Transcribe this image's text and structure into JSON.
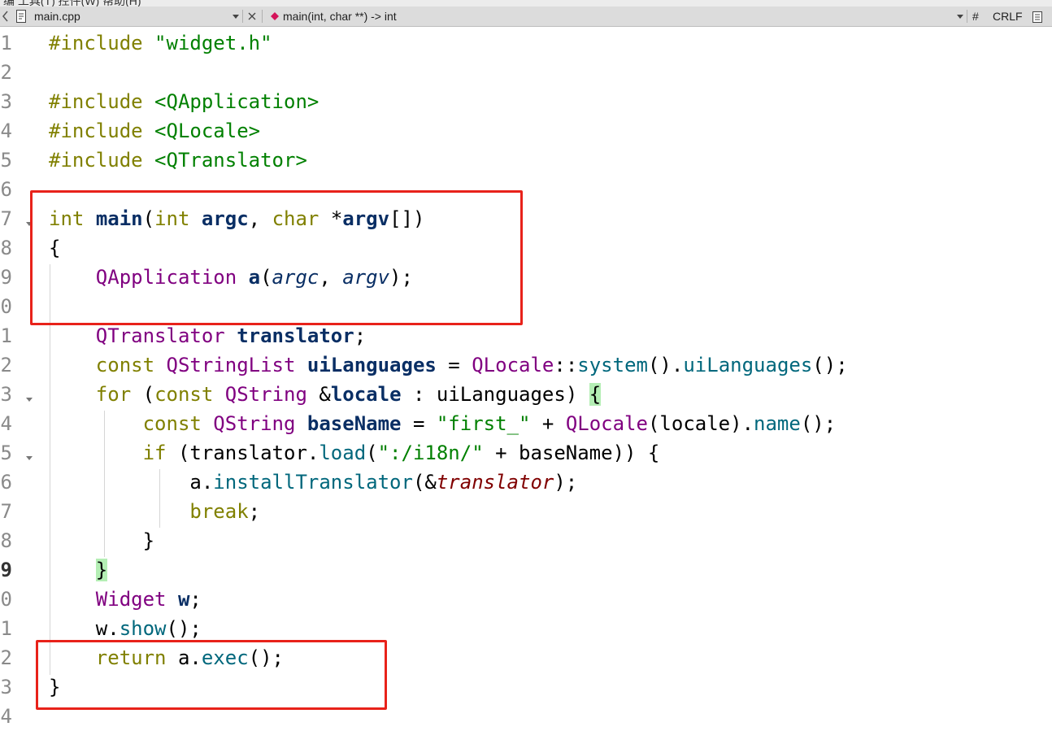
{
  "window": {
    "menu_fragments": "编  工具(T)  控件(W)  帮助(H)"
  },
  "tabbar": {
    "file_name": "main.cpp",
    "function_signature": "main(int, char **) -> int",
    "hash_symbol": "#",
    "line_ending": "CRLF",
    "file_icon": "document-icon",
    "function_icon": "function-diamond-icon",
    "dropdown_icon": "triangle-down-icon",
    "close_icon": "x-icon",
    "split_icon": "split-view-icon"
  },
  "editor": {
    "current_line": 19,
    "line_numbers": [
      "1",
      "2",
      "3",
      "4",
      "5",
      "6",
      "7",
      "8",
      "9",
      "0",
      "1",
      "2",
      "3",
      "4",
      "5",
      "6",
      "7",
      "8",
      "9",
      "0",
      "1",
      "2",
      "3",
      "4"
    ],
    "lines": [
      {
        "include_kw": "#include",
        "include_path": "\"widget.h\""
      },
      {},
      {
        "include_kw": "#include",
        "include_path": "<QApplication>"
      },
      {
        "include_kw": "#include",
        "include_path": "<QLocale>"
      },
      {
        "include_kw": "#include",
        "include_path": "<QTranslator>"
      },
      {},
      {
        "t1": "int",
        "t2": " ",
        "t3": "main",
        "t4": "(",
        "t5": "int",
        "t6": " ",
        "t7": "argc",
        "t8": ", ",
        "t9": "char",
        "t10": " *",
        "t11": "argv",
        "t12": "[])"
      },
      {
        "t1": "{"
      },
      {
        "t1": "    ",
        "t2": "QApplication",
        "t3": " ",
        "t4": "a",
        "t5": "(",
        "t6": "argc",
        "t7": ", ",
        "t8": "argv",
        "t9": ");"
      },
      {},
      {
        "t1": "    ",
        "t2": "QTranslator",
        "t3": " ",
        "t4": "translator",
        "t5": ";"
      },
      {
        "t1": "    ",
        "t2": "const",
        "t3": " ",
        "t4": "QStringList",
        "t5": " ",
        "t6": "uiLanguages",
        "t7": " = ",
        "t8": "QLocale",
        "t9": "::",
        "t10": "system",
        "t11": "().",
        "t12": "uiLanguages",
        "t13": "();"
      },
      {
        "t1": "    ",
        "t2": "for",
        "t3": " (",
        "t4": "const",
        "t5": " ",
        "t6": "QString",
        "t7": " &",
        "t8": "locale",
        "t9": " : uiLanguages) ",
        "t10": "{"
      },
      {
        "t1": "        ",
        "t2": "const",
        "t3": " ",
        "t4": "QString",
        "t5": " ",
        "t6": "baseName",
        "t7": " = ",
        "t8": "\"first_\"",
        "t9": " + ",
        "t10": "QLocale",
        "t11": "(locale).",
        "t12": "name",
        "t13": "();"
      },
      {
        "t1": "        ",
        "t2": "if",
        "t3": " (translator.",
        "t4": "load",
        "t5": "(",
        "t6": "\":/i18n/\"",
        "t7": " + baseName)) {"
      },
      {
        "t1": "            ",
        "t2": "a",
        "t3": ".",
        "t4": "installTranslator",
        "t5": "(&",
        "t6": "translator",
        "t7": ");"
      },
      {
        "t1": "            ",
        "t2": "break",
        "t3": ";"
      },
      {
        "t1": "        }"
      },
      {
        "t1": "    ",
        "t2": "}"
      },
      {
        "t1": "    ",
        "t2": "Widget",
        "t3": " ",
        "t4": "w",
        "t5": ";"
      },
      {
        "t1": "    ",
        "t2": "w",
        "t3": ".",
        "t4": "show",
        "t5": "();"
      },
      {
        "t1": "    ",
        "t2": "return",
        "t3": " ",
        "t4": "a",
        "t5": ".",
        "t6": "exec",
        "t7": "();"
      },
      {
        "t1": "}"
      },
      {}
    ]
  },
  "colors": {
    "keyword": "#808000",
    "type": "#800080",
    "string": "#008000",
    "function": "#00677c",
    "declaration": "#092e64",
    "annotation_box": "#e8221a",
    "brace_match": "#b4eeb4"
  }
}
